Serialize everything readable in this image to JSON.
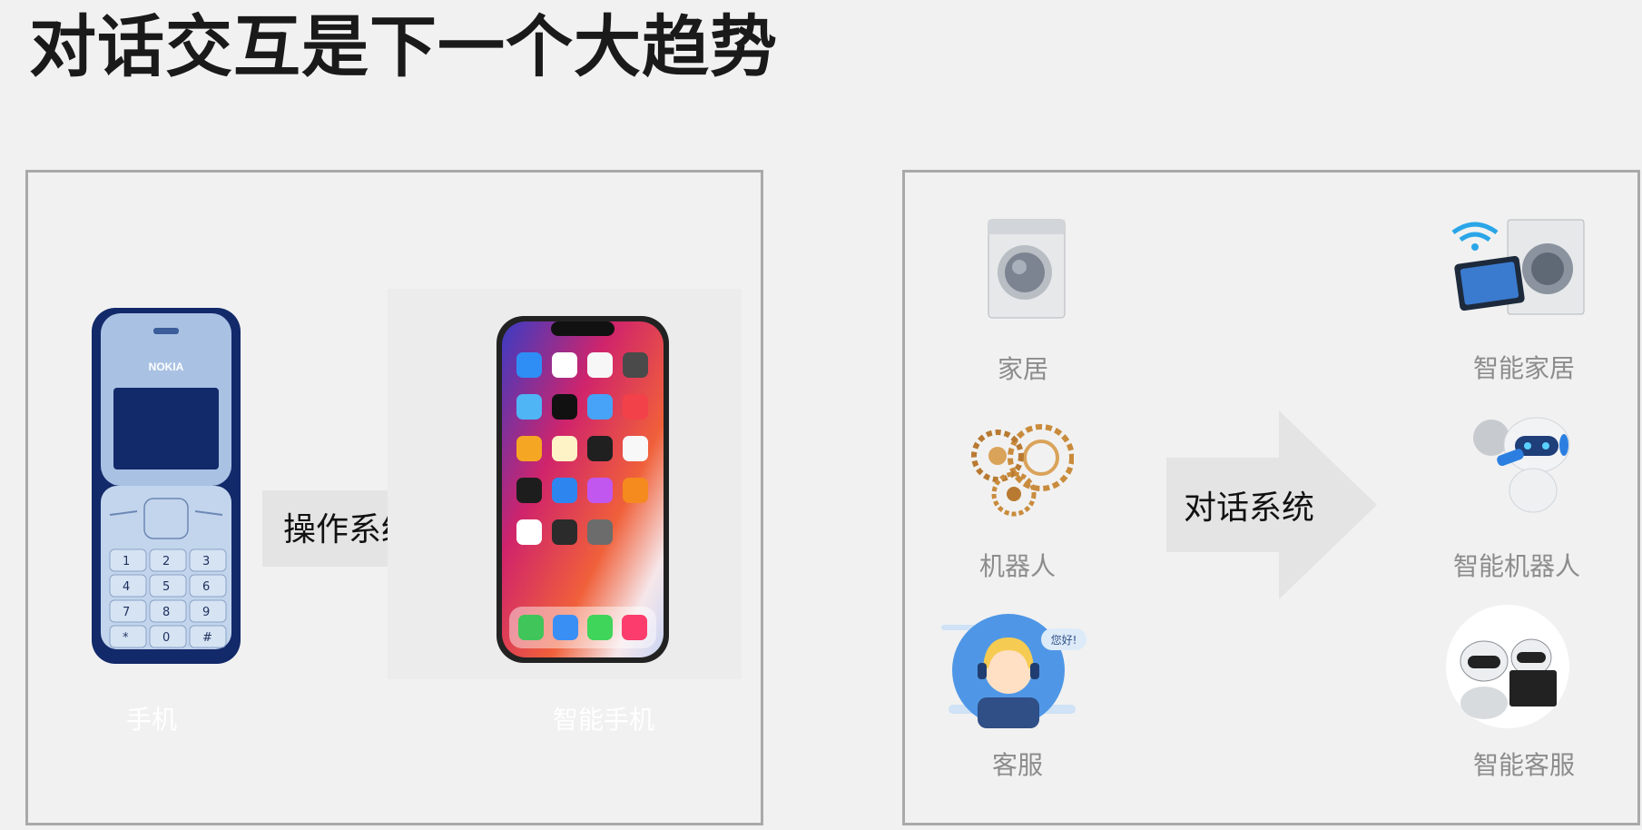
{
  "slide": {
    "title": "对话交互是下一个大趋势"
  },
  "left_panel": {
    "arrow_label": "操作系统",
    "feature_phone_caption": "手机",
    "smartphone_caption": "智能手机",
    "nokia_brand": "NOKIA",
    "keypad": [
      "1",
      "2",
      "3",
      "4",
      "5",
      "6",
      "7",
      "8",
      "9",
      "*",
      "0",
      "#"
    ]
  },
  "right_panel": {
    "arrow_label": "对话系统",
    "items_left": [
      {
        "caption": "家居",
        "icon": "washing-machine-icon"
      },
      {
        "caption": "机器人",
        "icon": "gears-icon"
      },
      {
        "caption": "客服",
        "icon": "customer-service-agent-icon"
      }
    ],
    "items_right": [
      {
        "caption": "智能家居",
        "icon": "smart-washer-tablet-icon"
      },
      {
        "caption": "智能机器人",
        "icon": "smart-robot-icon"
      },
      {
        "caption": "智能客服",
        "icon": "robot-agents-icon"
      }
    ],
    "agent_bubble": "您好!"
  },
  "colors": {
    "background": "#f1f1f1",
    "panel_border": "#a9a9a9",
    "arrow": "#e4e4e4",
    "caption": "#8c8c8c",
    "nokia_blue": "#12296a"
  }
}
